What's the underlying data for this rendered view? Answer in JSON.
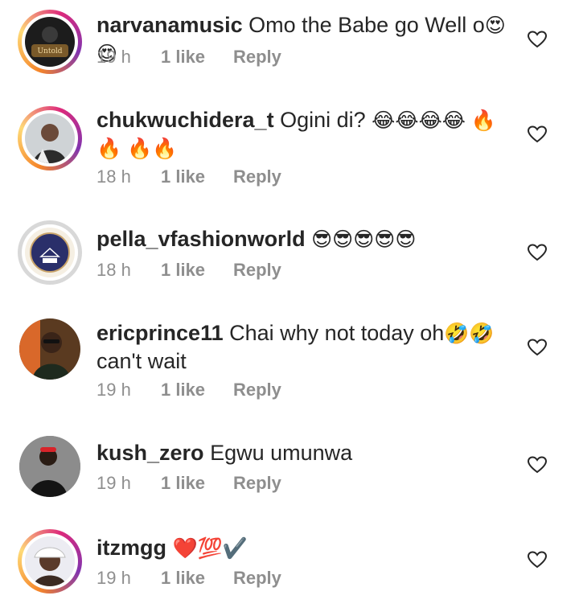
{
  "comments": [
    {
      "username": "narvanamusic",
      "text": " Omo the Babe go Well o",
      "emoji": "😍😍",
      "time": "19 h",
      "likes": "1 like",
      "reply": "Reply",
      "avatar_icon": "user-avatar-icon"
    },
    {
      "username": "chukwuchidera_t",
      "text": " Ogini di? ",
      "emoji": "😂😂😂😂 🔥🔥 🔥🔥",
      "time": "18 h",
      "likes": "1 like",
      "reply": "Reply",
      "avatar_icon": "user-avatar-icon"
    },
    {
      "username": "pella_vfashionworld",
      "text": " ",
      "emoji": "😎😎😎😎😎",
      "time": "18 h",
      "likes": "1 like",
      "reply": "Reply",
      "avatar_icon": "user-avatar-icon"
    },
    {
      "username": "ericprince11",
      "text": " Chai why not today oh",
      "emoji": "🤣🤣",
      "text2": "can't wait",
      "time": "19 h",
      "likes": "1 like",
      "reply": "Reply",
      "avatar_icon": "user-avatar-icon"
    },
    {
      "username": "kush_zero",
      "text": " Egwu umunwa",
      "emoji": "",
      "time": "19 h",
      "likes": "1 like",
      "reply": "Reply",
      "avatar_icon": "user-avatar-icon"
    },
    {
      "username": "itzmgg",
      "text": " ",
      "emoji": "❤️💯✔️",
      "time": "19 h",
      "likes": "1 like",
      "reply": "Reply",
      "avatar_icon": "user-avatar-icon"
    }
  ],
  "colors": {
    "text": "#262626",
    "meta": "#8e8e8e",
    "ring": "#dd2a7b"
  },
  "icons": {
    "like": "heart-outline-icon"
  }
}
